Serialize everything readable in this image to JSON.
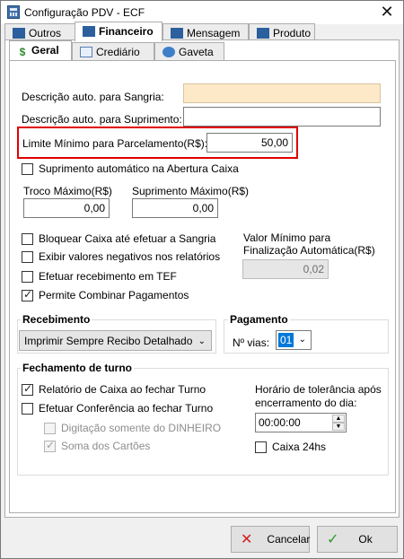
{
  "window": {
    "title": "Configuração PDV - ECF"
  },
  "tabs_top": [
    "Outros",
    "Financeiro",
    "Mensagem",
    "Produto"
  ],
  "tabs_sub": [
    "Geral",
    "Crediário",
    "Gaveta"
  ],
  "fields": {
    "sangria_label": "Descrição auto. para Sangria:",
    "sangria_value": "",
    "suprimento_label": "Descrição auto. para Suprimento:",
    "suprimento_value": "",
    "parcelamento_label": "Limite Mínimo para Parcelamento(R$):",
    "parcelamento_value": "50,00",
    "suprimento_auto_label": "Suprimento automático na Abertura Caixa",
    "troco_label": "Troco Máximo(R$)",
    "troco_value": "0,00",
    "suprimento_max_label": "Suprimento Máximo(R$)",
    "suprimento_max_value": "0,00"
  },
  "checks": [
    {
      "label": "Bloquear Caixa até efetuar a Sangria",
      "checked": false
    },
    {
      "label": "Exibir valores negativos nos relatórios",
      "checked": false
    },
    {
      "label": "Efetuar recebimento em TEF",
      "checked": false
    },
    {
      "label": "Permite Combinar Pagamentos",
      "checked": true
    }
  ],
  "valor_minimo": {
    "label_line1": "Valor Mínimo para",
    "label_line2": "Finalização Automática(R$)",
    "value": "0,02"
  },
  "recebimento": {
    "title": "Recebimento",
    "selected": "Imprimir Sempre Recibo Detalhado"
  },
  "pagamento": {
    "title": "Pagamento",
    "vias_label": "Nº vias:",
    "vias_value": "01"
  },
  "fechamento": {
    "title": "Fechamento de turno",
    "relatorio_label": "Relatório de Caixa ao fechar Turno",
    "conferencia_label": "Efetuar Conferência ao fechar Turno",
    "digitacao_label": "Digitação somente do DINHEIRO",
    "soma_label": "Soma dos Cartões",
    "tolerancia_line1": "Horário de tolerância após",
    "tolerancia_line2": "encerramento do dia:",
    "tolerancia_value": "00:00:00",
    "caixa24_label": "Caixa 24hs"
  },
  "buttons": {
    "cancel": "Cancelar",
    "ok": "Ok"
  },
  "colors": {
    "highlight_field": "#fde9c8",
    "outline": "#e00000",
    "selection": "#0078d7"
  }
}
